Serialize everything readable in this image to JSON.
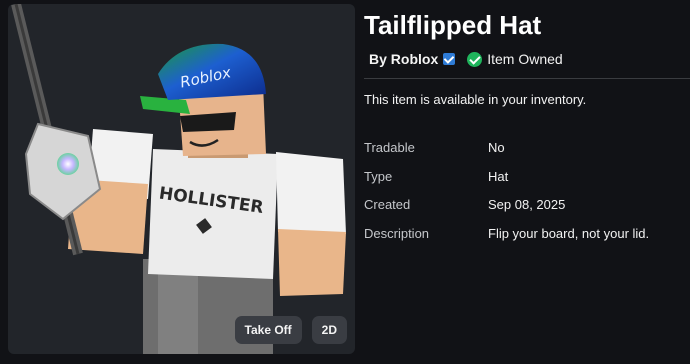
{
  "item": {
    "title": "Tailflipped Hat",
    "creator": "By Roblox",
    "owned_label": "Item Owned",
    "availability": "This item is available in your inventory."
  },
  "preview": {
    "take_off_label": "Take Off",
    "view_2d_label": "2D",
    "hat_text": "Roblox",
    "shirt_text": "HOLLISTER"
  },
  "details": [
    {
      "label": "Tradable",
      "value": "No"
    },
    {
      "label": "Type",
      "value": "Hat"
    },
    {
      "label": "Created",
      "value": "Sep 08, 2025"
    },
    {
      "label": "Description",
      "value": "Flip your board, not your lid."
    }
  ]
}
